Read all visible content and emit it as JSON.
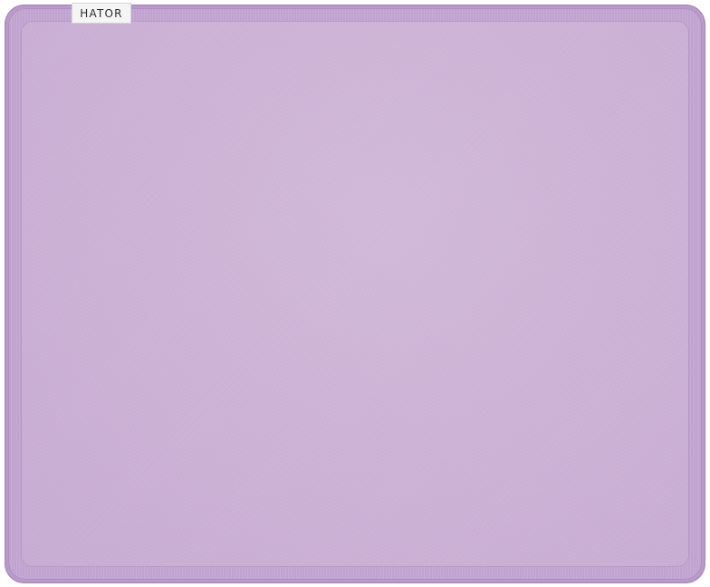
{
  "product": {
    "brand_label": "HATOR",
    "colors": {
      "surface": "#cdb3d6",
      "border": "#b99ac8",
      "tag_background": "#f5f5f5",
      "tag_text": "#2c2c2c"
    }
  }
}
